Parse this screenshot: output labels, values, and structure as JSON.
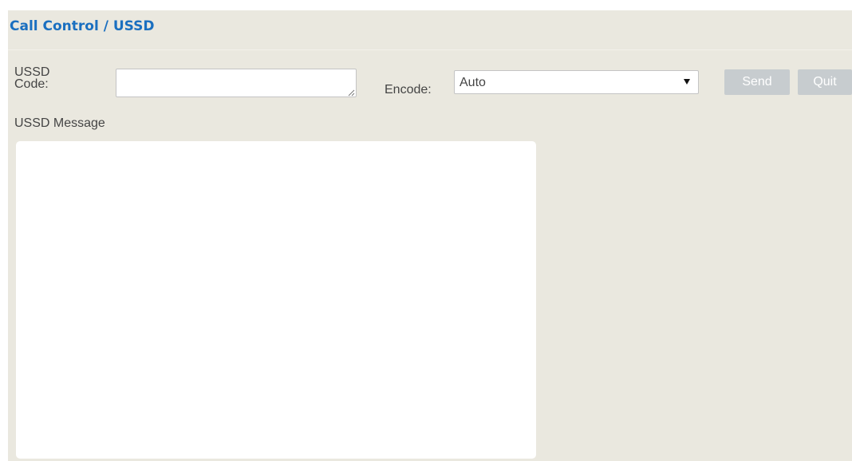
{
  "header": {
    "title": "Call Control / USSD"
  },
  "form": {
    "code_label": "USSD Code:",
    "code_value": "",
    "encode_label": "Encode:",
    "encode_value": "Auto",
    "send_label": "Send",
    "quit_label": "Quit",
    "buttons_state": "disabled"
  },
  "message": {
    "label": "USSD Message",
    "content": ""
  },
  "colors": {
    "title": "#1a6fc0",
    "panel_background": "#eae8df",
    "disabled_button": "#c7cccf"
  },
  "icons": {
    "select_arrow": "chevron-down-icon",
    "textarea_grip": "resize-grip-icon"
  }
}
